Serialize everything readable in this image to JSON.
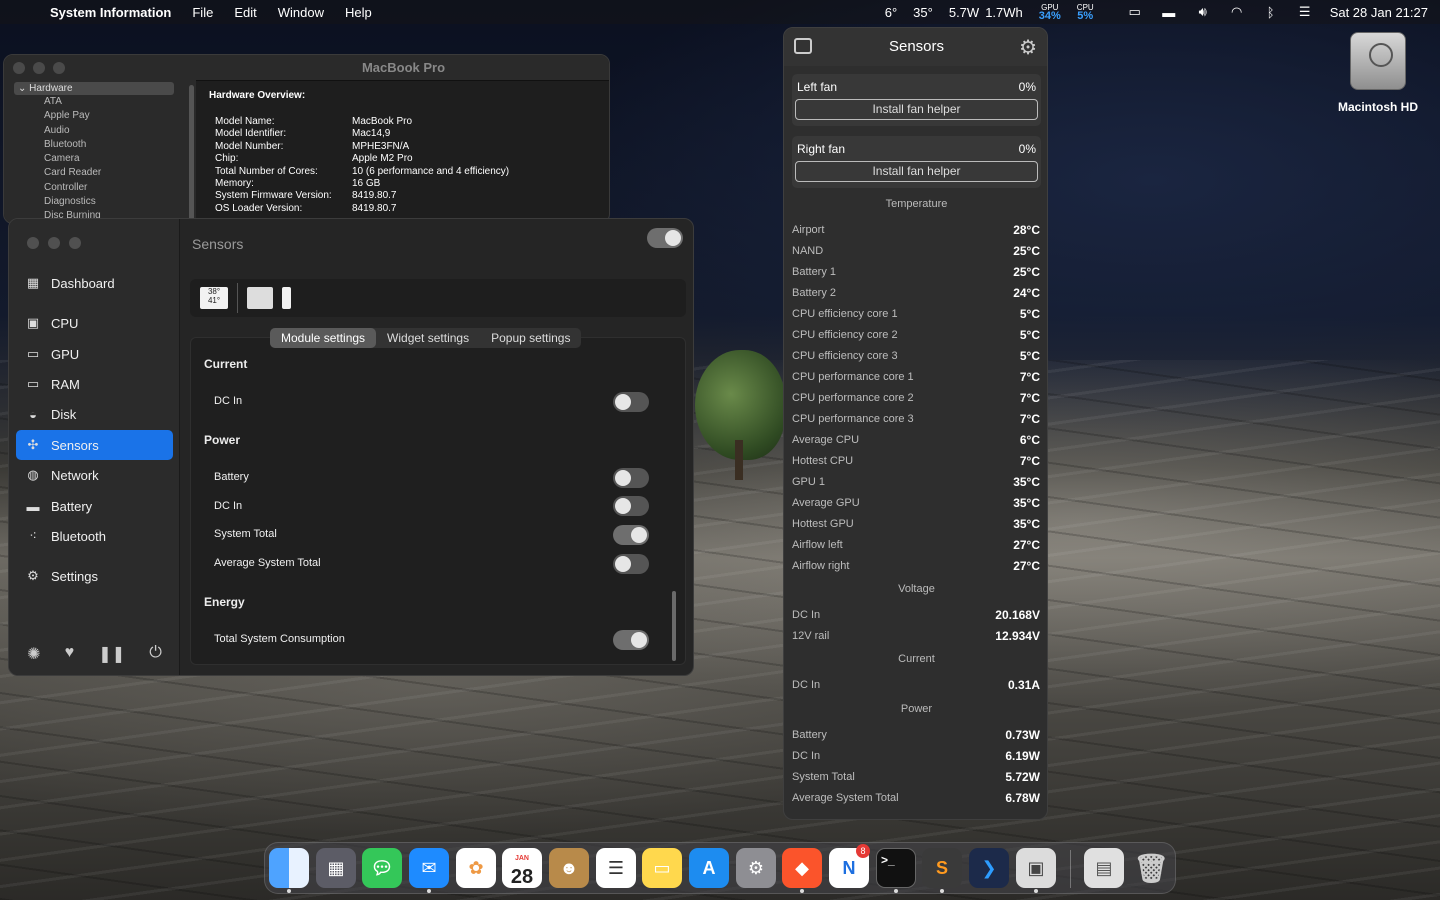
{
  "menubar": {
    "app": "System Information",
    "menus": [
      "File",
      "Edit",
      "Window",
      "Help"
    ],
    "stats": {
      "temp1": "6°",
      "temp2": "35°",
      "power": "5.7W",
      "energy": "1.7Wh"
    },
    "gpu": {
      "label": "GPU",
      "value": "34%"
    },
    "cpu": {
      "label": "CPU",
      "value": "5%"
    },
    "datetime": "Sat 28 Jan  21:27"
  },
  "sysinfo": {
    "title": "MacBook Pro",
    "tree_header": "Hardware",
    "tree_items": [
      "ATA",
      "Apple Pay",
      "Audio",
      "Bluetooth",
      "Camera",
      "Card Reader",
      "Controller",
      "Diagnostics",
      "Disc Burning"
    ],
    "overview_title": "Hardware Overview:",
    "rows": [
      {
        "k": "Model Name:",
        "v": "MacBook Pro"
      },
      {
        "k": "Model Identifier:",
        "v": "Mac14,9"
      },
      {
        "k": "Model Number:",
        "v": "MPHE3FN/A"
      },
      {
        "k": "Chip:",
        "v": "Apple M2 Pro"
      },
      {
        "k": "Total Number of Cores:",
        "v": "10 (6 performance and 4 efficiency)"
      },
      {
        "k": "Memory:",
        "v": "16 GB"
      },
      {
        "k": "System Firmware Version:",
        "v": "8419.80.7"
      },
      {
        "k": "OS Loader Version:",
        "v": "8419.80.7"
      }
    ]
  },
  "stats": {
    "title": "Sensors",
    "nav": [
      {
        "label": "Dashboard",
        "icon": "grid"
      },
      {
        "label": "CPU",
        "icon": "cpu"
      },
      {
        "label": "GPU",
        "icon": "gpu"
      },
      {
        "label": "RAM",
        "icon": "ram"
      },
      {
        "label": "Disk",
        "icon": "disk"
      },
      {
        "label": "Sensors",
        "icon": "sensors"
      },
      {
        "label": "Network",
        "icon": "globe"
      },
      {
        "label": "Battery",
        "icon": "battery"
      },
      {
        "label": "Bluetooth",
        "icon": "bluetooth"
      },
      {
        "label": "Settings",
        "icon": "gear"
      }
    ],
    "widget_preview": {
      "top": "38°",
      "bottom": "41°"
    },
    "tabs": [
      "Module settings",
      "Widget settings",
      "Popup settings"
    ],
    "sections": {
      "current": "Current",
      "power": "Power",
      "energy": "Energy"
    },
    "rows": {
      "current_dc": "DC In",
      "power_battery": "Battery",
      "power_dc": "DC In",
      "power_total": "System Total",
      "power_avg": "Average System Total",
      "energy_total": "Total System Consumption"
    }
  },
  "sensors": {
    "title": "Sensors",
    "fans": [
      {
        "name": "Left fan",
        "value": "0%",
        "button": "Install fan helper"
      },
      {
        "name": "Right fan",
        "value": "0%",
        "button": "Install fan helper"
      }
    ],
    "temperature_title": "Temperature",
    "temperature": [
      {
        "n": "Airport",
        "v": "28°C"
      },
      {
        "n": "NAND",
        "v": "25°C"
      },
      {
        "n": "Battery 1",
        "v": "25°C"
      },
      {
        "n": "Battery 2",
        "v": "24°C"
      },
      {
        "n": "CPU efficiency core 1",
        "v": "5°C"
      },
      {
        "n": "CPU efficiency core 2",
        "v": "5°C"
      },
      {
        "n": "CPU efficiency core 3",
        "v": "5°C"
      },
      {
        "n": "CPU performance core 1",
        "v": "7°C"
      },
      {
        "n": "CPU performance core 2",
        "v": "7°C"
      },
      {
        "n": "CPU performance core 3",
        "v": "7°C"
      },
      {
        "n": "Average CPU",
        "v": "6°C"
      },
      {
        "n": "Hottest CPU",
        "v": "7°C"
      },
      {
        "n": "GPU 1",
        "v": "35°C"
      },
      {
        "n": "Average GPU",
        "v": "35°C"
      },
      {
        "n": "Hottest GPU",
        "v": "35°C"
      },
      {
        "n": "Airflow left",
        "v": "27°C"
      },
      {
        "n": "Airflow right",
        "v": "27°C"
      }
    ],
    "voltage_title": "Voltage",
    "voltage": [
      {
        "n": "DC In",
        "v": "20.168V"
      },
      {
        "n": "12V rail",
        "v": "12.934V"
      }
    ],
    "current_title": "Current",
    "current": [
      {
        "n": "DC In",
        "v": "0.31A"
      }
    ],
    "power_title": "Power",
    "power": [
      {
        "n": "Battery",
        "v": "0.73W"
      },
      {
        "n": "DC In",
        "v": "6.19W"
      },
      {
        "n": "System Total",
        "v": "5.72W"
      },
      {
        "n": "Average System Total",
        "v": "6.78W"
      }
    ]
  },
  "desktop": {
    "hd_label": "Macintosh HD"
  },
  "dock": {
    "calendar_month": "JAN",
    "calendar_day": "28",
    "badge": "8"
  }
}
